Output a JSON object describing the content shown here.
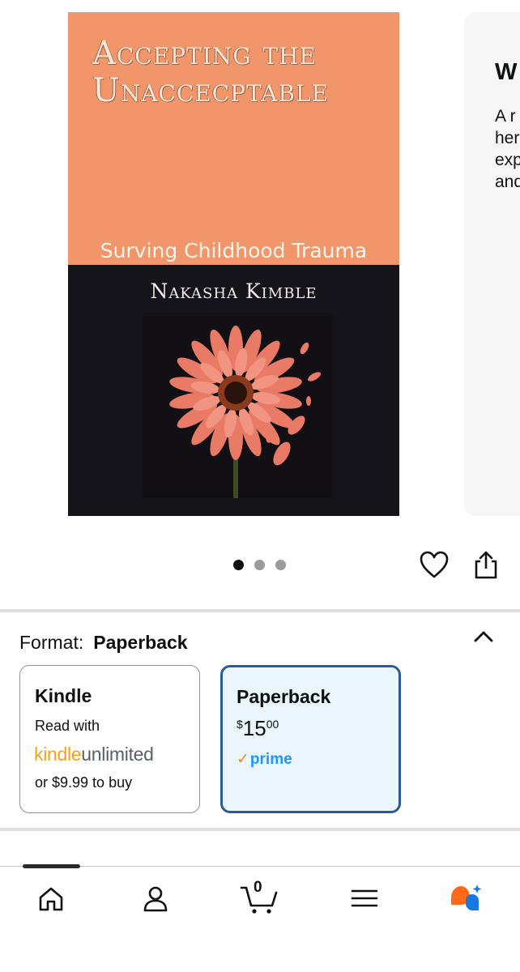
{
  "book": {
    "title_line1": "Accepting the",
    "title_line2": "Unaccecptable",
    "subtitle": "Surving Childhood Trauma",
    "author": "Nakasha Kimble"
  },
  "next_panel": {
    "heading": "W",
    "lines": [
      "A r",
      "her",
      "exp",
      "and"
    ]
  },
  "carousel": {
    "slide_count": 3,
    "active_index": 0
  },
  "format": {
    "label": "Format:",
    "selected": "Paperback",
    "options": [
      {
        "name": "Kindle",
        "read_with": "Read with",
        "ku_kindle": "kindle",
        "ku_unlimited": "unlimited",
        "buy_text": "or $9.99 to buy"
      },
      {
        "name": "Paperback",
        "price_symbol": "$",
        "price_whole": "15",
        "price_fraction": "00",
        "prime_check": "✓",
        "prime_text": "prime"
      }
    ]
  },
  "nav": {
    "cart_count": "0",
    "items": [
      "home-icon",
      "account-icon",
      "cart-icon",
      "menu-icon",
      "assistant-icon"
    ]
  },
  "colors": {
    "cover_top": "#f0966a",
    "cover_bottom": "#16141b",
    "selected_border": "#2a5c9a",
    "selected_bg": "#eaf5fc",
    "prime_blue": "#1a98ff",
    "kindle_orange": "#f0a21e"
  }
}
